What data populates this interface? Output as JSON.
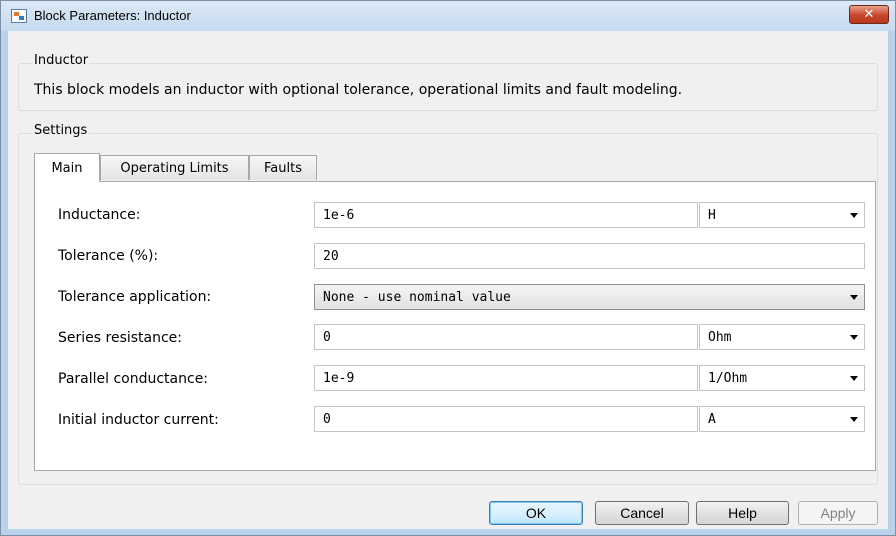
{
  "window": {
    "title": "Block Parameters: Inductor",
    "close_glyph": "✕"
  },
  "block": {
    "group_label": "Inductor",
    "description": "This block models an inductor with optional tolerance, operational limits and fault modeling."
  },
  "settings": {
    "group_label": "Settings",
    "tabs": [
      {
        "label": "Main",
        "active": true
      },
      {
        "label": "Operating Limits",
        "active": false
      },
      {
        "label": "Faults",
        "active": false
      }
    ],
    "params": [
      {
        "label": "Inductance:",
        "value": "1e-6",
        "unit": "H"
      },
      {
        "label": "Tolerance (%):",
        "value": "20"
      },
      {
        "label": "Tolerance application:",
        "value": "None - use nominal value"
      },
      {
        "label": "Series resistance:",
        "value": "0",
        "unit": "Ohm"
      },
      {
        "label": "Parallel conductance:",
        "value": "1e-9",
        "unit": "1/Ohm"
      },
      {
        "label": "Initial inductor current:",
        "value": "0",
        "unit": "A"
      }
    ]
  },
  "buttons": {
    "ok": "OK",
    "cancel": "Cancel",
    "help": "Help",
    "apply": "Apply"
  },
  "icons": {
    "app": "simulink-block-icon",
    "close": "close-icon",
    "dropdown": "chevron-down-icon"
  }
}
